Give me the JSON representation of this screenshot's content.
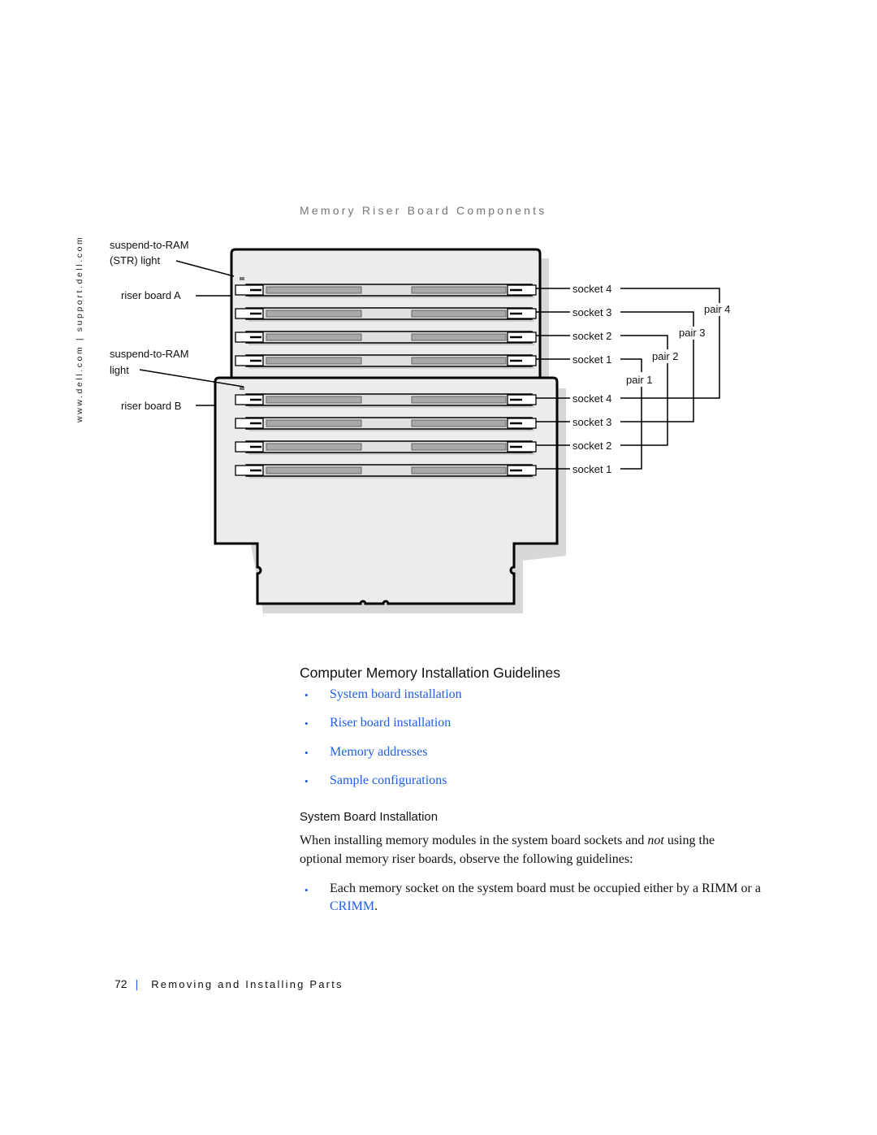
{
  "side_url": "www.dell.com | support.dell.com",
  "figure": {
    "title": "Memory Riser Board Components",
    "callouts_left": {
      "str_light_a_line1": "suspend-to-RAM",
      "str_light_a_line2": "(STR) light",
      "riser_a": "riser board A",
      "str_light_b_line1": "suspend-to-RAM",
      "str_light_b_line2": "light",
      "riser_b": "riser board B"
    },
    "riser_a_sockets": [
      "socket 4",
      "socket 3",
      "socket 2",
      "socket 1"
    ],
    "riser_b_sockets": [
      "socket 4",
      "socket 3",
      "socket 2",
      "socket 1"
    ],
    "pairs": [
      "pair 1",
      "pair 2",
      "pair 3",
      "pair 4"
    ]
  },
  "section": {
    "heading": "Computer Memory Installation Guidelines",
    "toc": [
      {
        "label": "System board installation"
      },
      {
        "label": "Riser board installation"
      },
      {
        "label": "Memory addresses"
      },
      {
        "label": "Sample configurations"
      }
    ]
  },
  "subsection": {
    "heading": "System Board Installation",
    "para_a": "When installing memory modules in the system board sockets and ",
    "para_em": "not",
    "para_b": " using the optional memory riser boards, observe the following guidelines:",
    "bullet_a": "Each memory socket on the system board must be occupied either by a RIMM or a ",
    "bullet_link": "CRIMM",
    "bullet_b": "."
  },
  "footer": {
    "page_number": "72",
    "separator": "|",
    "section_title": "Removing and Installing Parts"
  },
  "colors": {
    "link": "#1e5ee8",
    "board_fill": "#ececec",
    "board_shadow": "#d4d4d4"
  }
}
